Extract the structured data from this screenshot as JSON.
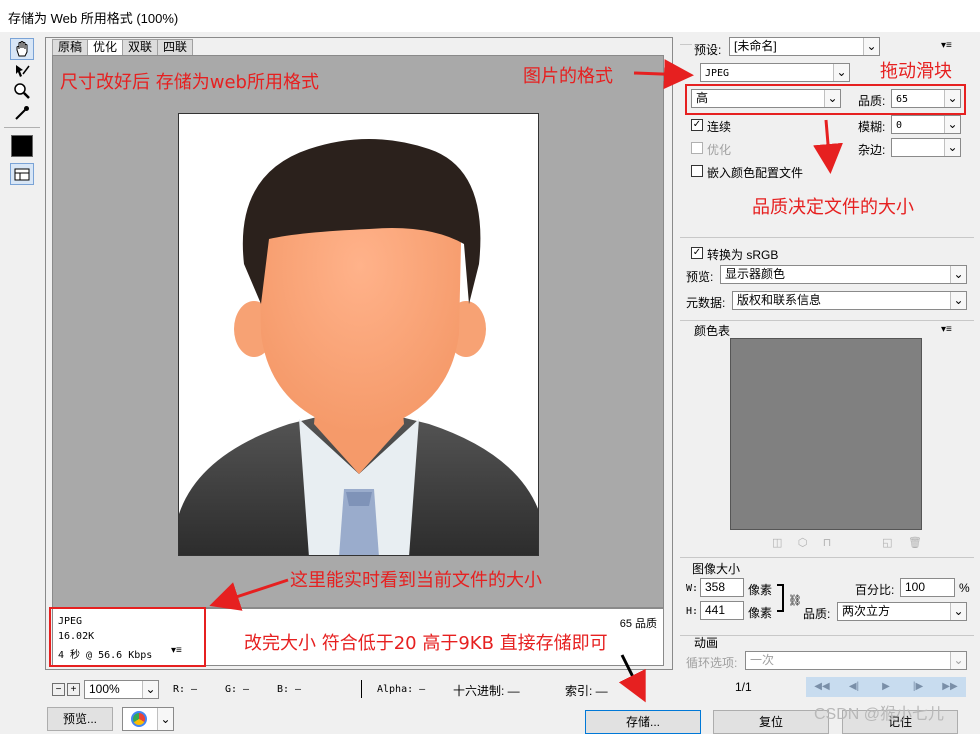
{
  "window": {
    "title": "存储为 Web 所用格式 (100%)"
  },
  "tools": [
    {
      "name": "hand-tool-icon"
    },
    {
      "name": "slice-select-tool-icon"
    },
    {
      "name": "zoom-tool-icon"
    },
    {
      "name": "eyedropper-tool-icon"
    },
    {
      "name": "eyedropper-color-swatch"
    },
    {
      "name": "toggle-slices-icon"
    }
  ],
  "tabs": [
    "原稿",
    "优化",
    "双联",
    "四联"
  ],
  "info": {
    "format": "JPEG",
    "size": "16.02K",
    "time": "4 秒 @ 56.6 Kbps",
    "quality": "65 品质"
  },
  "status": {
    "zoom": "100%",
    "r": "R: —",
    "g": "G: —",
    "b": "B: —",
    "alpha": "Alpha: —",
    "hex": "十六进制: —",
    "index": "索引: —"
  },
  "buttons": {
    "preview": "预览...",
    "save": "存储...",
    "reset": "复位",
    "remember": "记住"
  },
  "settings": {
    "preset_label": "预设:",
    "preset_value": "[未命名]",
    "format_value": "JPEG",
    "compression_value": "高",
    "quality_label": "品质:",
    "quality_value": "65",
    "progressive_label": "连续",
    "blur_label": "模糊:",
    "blur_value": "0",
    "optimized_label": "优化",
    "matte_label": "杂边:",
    "embed_profile_label": "嵌入颜色配置文件",
    "convert_srgb_label": "转换为 sRGB",
    "preview_label": "预览:",
    "preview_value": "显示器颜色",
    "metadata_label": "元数据:",
    "metadata_value": "版权和联系信息"
  },
  "color_table": {
    "title": "颜色表"
  },
  "image_size": {
    "title": "图像大小",
    "w_label": "W:",
    "w_value": "358",
    "h_label": "H:",
    "h_value": "441",
    "unit": "像素",
    "percent_label": "百分比:",
    "percent_value": "100",
    "percent_unit": "%",
    "quality_label": "品质:",
    "quality_value": "两次立方"
  },
  "animation": {
    "title": "动画",
    "loop_label": "循环选项:",
    "loop_value": "一次",
    "frame": "1/1"
  },
  "annotations": {
    "a1": "尺寸改好后 存储为web所用格式",
    "a2": "图片的格式",
    "a3": "拖动滑块",
    "a4": "品质决定文件的大小",
    "a5": "这里能实时看到当前文件的大小",
    "a6": "改完大小 符合低于20 高于9KB 直接存储即可"
  },
  "watermark": "CSDN @猴小七儿",
  "colors": {
    "annotation": "#e62020",
    "canvas_bg": "#a9a9a9",
    "default_border": "#0078d7"
  }
}
